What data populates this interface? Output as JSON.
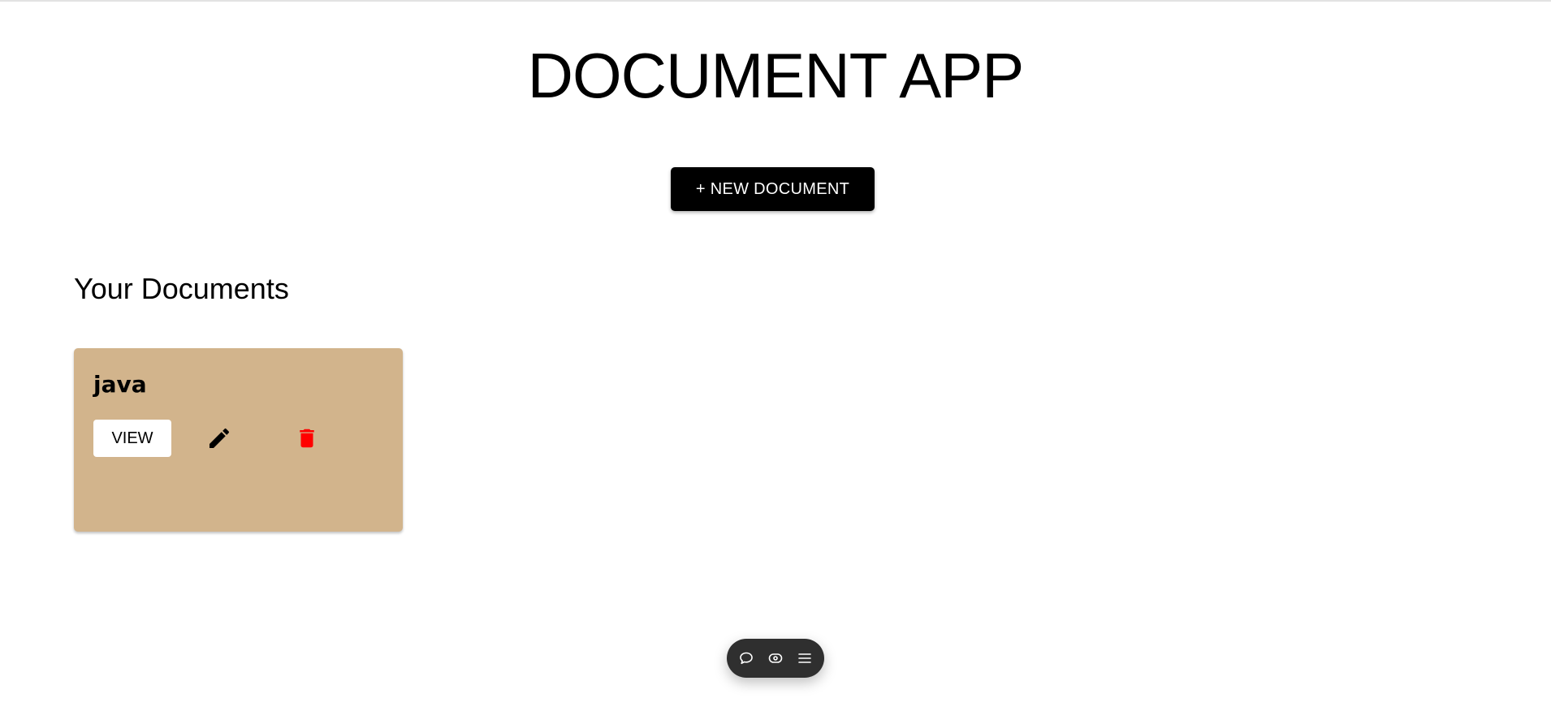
{
  "app": {
    "title": "DOCUMENT APP"
  },
  "actions": {
    "new_document_label": "+ NEW DOCUMENT"
  },
  "documents_section": {
    "heading": "Your Documents",
    "items": [
      {
        "title": "java",
        "view_label": "VIEW",
        "edit_icon": "pencil-icon",
        "delete_icon": "trash-icon"
      }
    ]
  },
  "toolbar": {
    "items": [
      {
        "icon": "comment-icon"
      },
      {
        "icon": "eye-icon"
      },
      {
        "icon": "menu-icon"
      }
    ]
  },
  "colors": {
    "card_background": "#d2b48c",
    "primary_button": "#000000",
    "delete_icon": "#ff0000",
    "toolbar_background": "#2f2f2f"
  }
}
